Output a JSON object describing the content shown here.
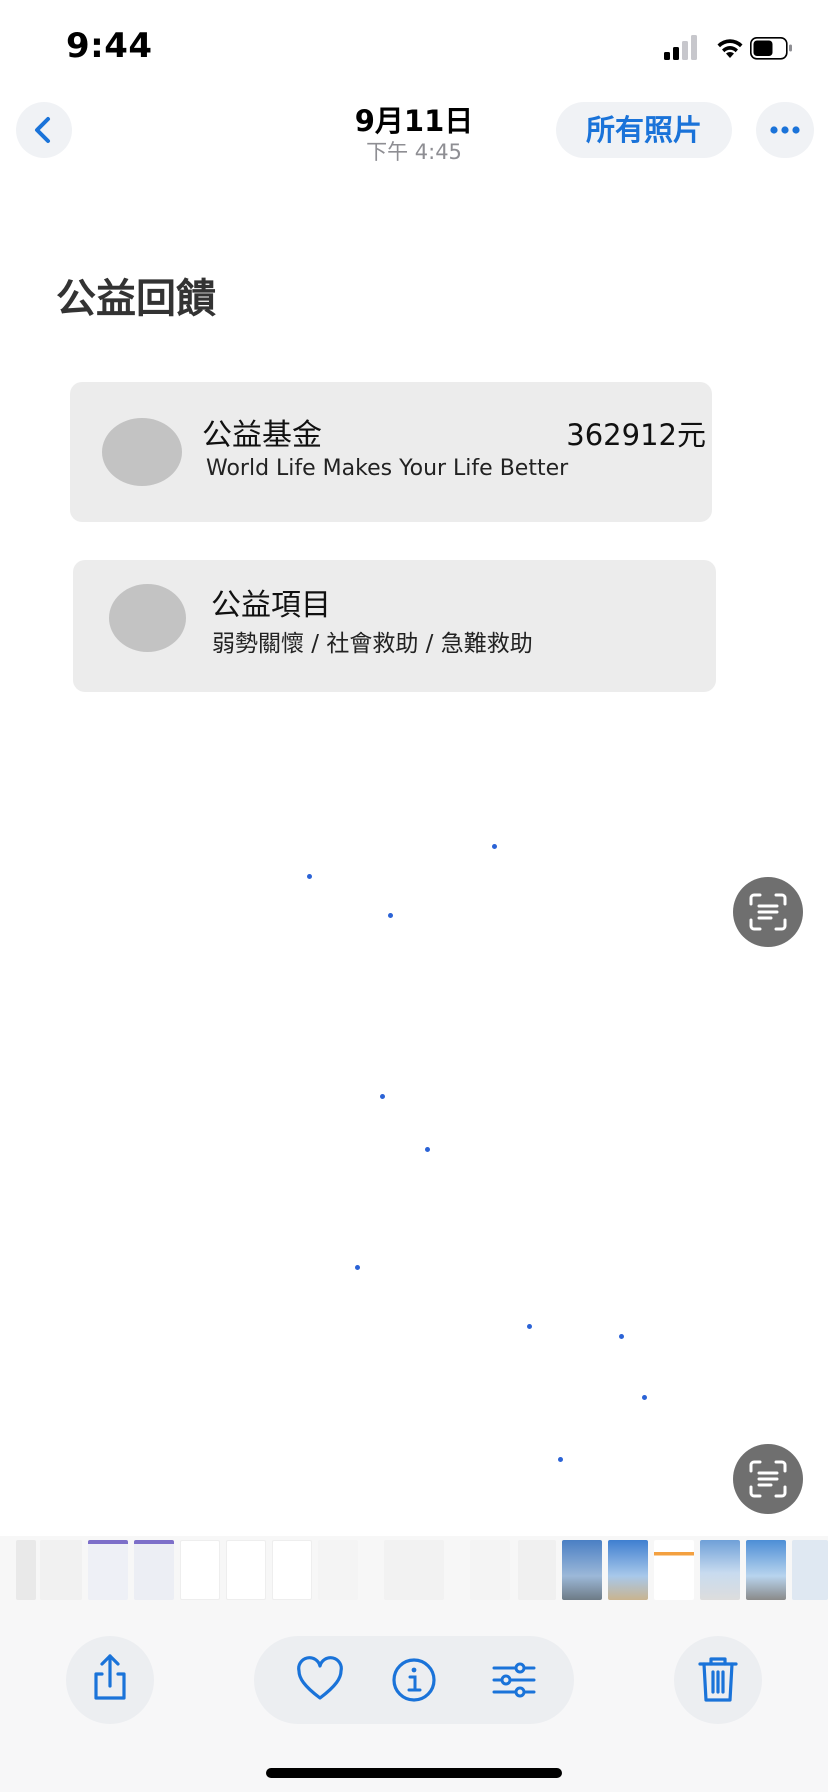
{
  "status_bar": {
    "time": "9:44",
    "icons": [
      "cellular-signal-icon",
      "wifi-icon",
      "battery-icon"
    ]
  },
  "nav": {
    "back_icon": "chevron-left-icon",
    "title": "9月11日",
    "subtitle": "下午 4:45",
    "all_photos_label": "所有照片",
    "more_icon": "ellipsis-icon"
  },
  "photo": {
    "heading": "公益回饋",
    "cards": [
      {
        "title": "公益基金",
        "amount": "362912元",
        "subtitle": "World Life Makes Your Life Better"
      },
      {
        "title": "公益項目",
        "subtitle": "弱勢關懷 / 社會救助 / 急難救助"
      }
    ],
    "live_text_icon": "live-text-icon"
  },
  "toolbar": {
    "share_icon": "share-icon",
    "favorite_icon": "heart-icon",
    "info_icon": "info-icon",
    "edit_icon": "adjust-sliders-icon",
    "delete_icon": "trash-icon"
  },
  "colors": {
    "accent": "#1a73d9",
    "card_bg": "#ececec",
    "avatar": "#c3c3c3",
    "live_text_bg": "#6f6f6f"
  }
}
